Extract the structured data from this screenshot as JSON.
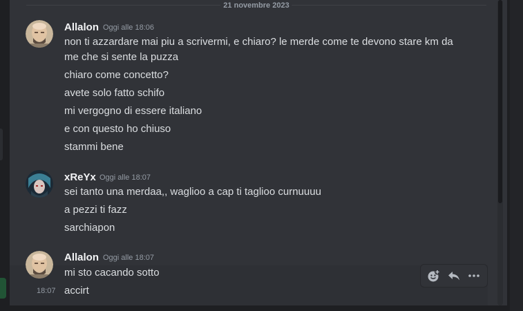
{
  "date_divider": "21 novembre 2023",
  "groups": [
    {
      "username": "Allalon",
      "timestamp": "Oggi alle 18:06",
      "messages": [
        "non ti azzardare mai piu a scrivermi, e chiaro? le merde come te devono stare km da",
        "me che si sente la puzza",
        "chiaro come concetto?",
        "avete solo fatto schifo",
        "mi vergogno di essere italiano",
        "e con questo ho chiuso",
        "stammi bene"
      ]
    },
    {
      "username": "xReYx",
      "timestamp": "Oggi alle 18:07",
      "messages": [
        "sei tanto una merdaa,, waglioo a cap ti taglioo curnuuuu",
        "a pezzi ti fazz",
        "sarchiapon"
      ]
    },
    {
      "username": "Allalon",
      "timestamp": "Oggi alle 18:07",
      "messages": [
        "mi sto cacando sotto",
        "accirt"
      ],
      "hover_time": "18:07"
    }
  ],
  "toolbar": {
    "icons": [
      "add-reaction-icon",
      "reply-icon",
      "more-options-icon"
    ]
  },
  "colors": {
    "background": "#313338",
    "username": "#f2f3f5",
    "message_text": "#dbdee1",
    "muted": "#949ba4"
  }
}
